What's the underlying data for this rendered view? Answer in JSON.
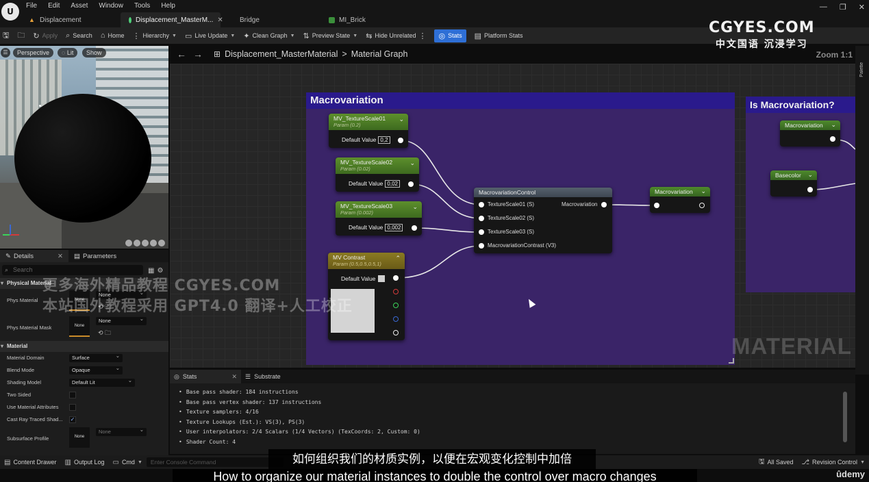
{
  "menu": [
    "File",
    "Edit",
    "Asset",
    "Window",
    "Tools",
    "Help"
  ],
  "tabs": [
    {
      "label": "Displacement"
    },
    {
      "label": "Displacement_MasterM..."
    },
    {
      "label": "Bridge"
    },
    {
      "label": "MI_Brick"
    }
  ],
  "toolbar": {
    "apply": "Apply",
    "search": "Search",
    "home": "Home",
    "hierarchy": "Hierarchy",
    "live_update": "Live Update",
    "clean_graph": "Clean Graph",
    "preview_state": "Preview State",
    "hide_unrelated": "Hide Unrelated",
    "stats": "Stats",
    "platform_stats": "Platform Stats"
  },
  "watermark": {
    "site": "CGYES.COM",
    "tagline": "中文国语 沉浸学习"
  },
  "viewport": {
    "perspective": "Perspective",
    "lit": "Lit",
    "show": "Show"
  },
  "details": {
    "tab_details": "Details",
    "tab_parameters": "Parameters",
    "search_placeholder": "Search",
    "section_physical": "Physical Material",
    "phys_material_label": "Phys Material",
    "phys_material_thumb": "None",
    "phys_material_value": "None",
    "phys_mask_label": "Phys Material Mask",
    "phys_mask_thumb": "None",
    "phys_mask_value": "None",
    "section_material": "Material",
    "domain_label": "Material Domain",
    "domain_value": "Surface",
    "blend_label": "Blend Mode",
    "blend_value": "Opaque",
    "shading_label": "Shading Model",
    "shading_value": "Default Lit",
    "two_sided_label": "Two Sided",
    "use_attr_label": "Use Material Attributes",
    "cast_ray_label": "Cast Ray Traced Shad...",
    "subsurface_label": "Subsurface Profile",
    "subsurface_thumb": "None",
    "subsurface_value": "None"
  },
  "breadcrumb": {
    "asset": "Displacement_MasterMaterial",
    "sep": ">",
    "graph": "Material Graph",
    "zoom": "Zoom 1:1"
  },
  "palette_label": "Palette",
  "graph": {
    "comment1": "Macrovariation",
    "comment2": "Is Macrovariation?",
    "default_value": "Default Value",
    "nodes": {
      "ts1": {
        "title": "MV_TextureScale01",
        "sub": "Param (0.2)",
        "value": "0,2"
      },
      "ts2": {
        "title": "MV_TextureScale02",
        "sub": "Param (0.02)",
        "value": "0,02"
      },
      "ts3": {
        "title": "MV_TextureScale03",
        "sub": "Param (0.002)",
        "value": "0,002"
      },
      "contrast": {
        "title": "MV Contrast",
        "sub": "Param (0.5,0.5,0.5,1)"
      },
      "control": {
        "title": "MacrovariationControl",
        "in1": "TextureScale01 (S)",
        "in2": "TextureScale02 (S)",
        "in3": "TextureScale03 (S)",
        "in4": "MacrovariationContrast (V3)",
        "out": "Macrovariation"
      },
      "mvout": {
        "title": "Macrovariation"
      },
      "mvin": {
        "title": "Macrovariation"
      },
      "basecolor": {
        "title": "Basecolor"
      }
    }
  },
  "overlay_watermark": {
    "line1": "更多海外精品教程 CGYES.COM",
    "line2": "本站国外教程采用 GPT4.0 翻译+人工校正",
    "material": "MATERIAL"
  },
  "stats": {
    "tab_stats": "Stats",
    "tab_substrate": "Substrate",
    "lines": [
      "Base pass shader: 184 instructions",
      "Base pass vertex shader: 137 instructions",
      "Texture samplers: 4/16",
      "Texture Lookups (Est.): VS(3), PS(3)",
      "User interpolators: 2/4 Scalars (1/4 Vectors) (TexCoords: 2, Custom: 0)",
      "Shader Count: 4"
    ]
  },
  "bottombar": {
    "content_drawer": "Content Drawer",
    "output_log": "Output Log",
    "cmd": "Cmd",
    "console_placeholder": "Enter Console Command",
    "all_saved": "All Saved",
    "revision_control": "Revision Control"
  },
  "subtitles": {
    "cn": "如何组织我们的材质实例，以便在宏观变化控制中加倍",
    "en": "How to organize our material instances to double the control over macro changes",
    "brand": "ûdemy"
  },
  "colors": {
    "accent": "#2e6fd6",
    "comment_head": "#2a1a8c",
    "comment_body": "#3a2468",
    "param_node": "#5d8f2c",
    "vector_node": "#8a7a22"
  }
}
